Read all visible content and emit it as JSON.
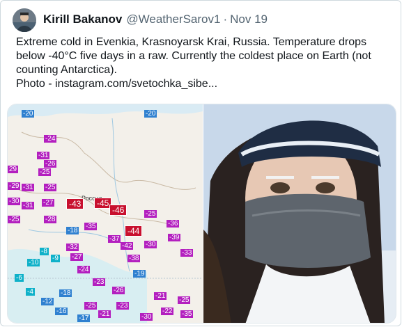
{
  "tweet": {
    "author_name": "Kirill Bakanov",
    "handle": "@WeatherSarov1",
    "separator": "·",
    "date": "Nov 19",
    "lines": [
      "Extreme cold in Evenkia, Krasnoyarsk Krai, Russia. Temperature drops",
      "below -40°C five days in a raw. Currently the coldest place on Earth (not",
      "counting Antarctica).",
      "Photo - instagram.com/svetochka_sibe..."
    ]
  },
  "map": {
    "place_label": "Россия",
    "highlight_values": [
      "-43",
      "-45",
      "-46",
      "-44"
    ],
    "labels": [
      {
        "t": "-20",
        "c": "blue"
      },
      {
        "t": "-24",
        "c": "purple"
      },
      {
        "t": "-31",
        "c": "purple"
      },
      {
        "t": "-26",
        "c": "purple"
      },
      {
        "t": "29",
        "c": "purple"
      },
      {
        "t": "-25",
        "c": "purple"
      },
      {
        "t": "-29",
        "c": "purple"
      },
      {
        "t": "-31",
        "c": "purple"
      },
      {
        "t": "-25",
        "c": "purple"
      },
      {
        "t": "-30",
        "c": "purple"
      },
      {
        "t": "-27",
        "c": "purple"
      },
      {
        "t": "-31",
        "c": "purple"
      },
      {
        "t": "-25",
        "c": "purple"
      },
      {
        "t": "-28",
        "c": "purple"
      },
      {
        "t": "-18",
        "c": "blue"
      },
      {
        "t": "-32",
        "c": "purple"
      },
      {
        "t": "-35",
        "c": "purple"
      },
      {
        "t": "-37",
        "c": "purple"
      },
      {
        "t": "-25",
        "c": "purple"
      },
      {
        "t": "-36",
        "c": "purple"
      },
      {
        "t": "-39",
        "c": "purple"
      },
      {
        "t": "-33",
        "c": "purple"
      },
      {
        "t": "-30",
        "c": "purple"
      },
      {
        "t": "-42",
        "c": "purple"
      },
      {
        "t": "-20",
        "c": "blue"
      },
      {
        "t": "-8",
        "c": "cyan"
      },
      {
        "t": "-9",
        "c": "cyan"
      },
      {
        "t": "-10",
        "c": "cyan"
      },
      {
        "t": "-27",
        "c": "purple"
      },
      {
        "t": "-24",
        "c": "purple"
      },
      {
        "t": "-23",
        "c": "purple"
      },
      {
        "t": "-26",
        "c": "purple"
      },
      {
        "t": "-18",
        "c": "blue"
      },
      {
        "t": "-19",
        "c": "blue"
      },
      {
        "t": "-21",
        "c": "purple"
      },
      {
        "t": "-23",
        "c": "purple"
      },
      {
        "t": "-25",
        "c": "purple"
      },
      {
        "t": "-22",
        "c": "purple"
      },
      {
        "t": "-30",
        "c": "purple"
      },
      {
        "t": "-35",
        "c": "purple"
      },
      {
        "t": "-6",
        "c": "cyan"
      },
      {
        "t": "-4",
        "c": "cyan"
      },
      {
        "t": "-12",
        "c": "blue"
      },
      {
        "t": "-16",
        "c": "blue"
      },
      {
        "t": "-17",
        "c": "blue"
      },
      {
        "t": "-21",
        "c": "purple"
      },
      {
        "t": "-25",
        "c": "purple"
      },
      {
        "t": "-38",
        "c": "purple"
      }
    ]
  }
}
